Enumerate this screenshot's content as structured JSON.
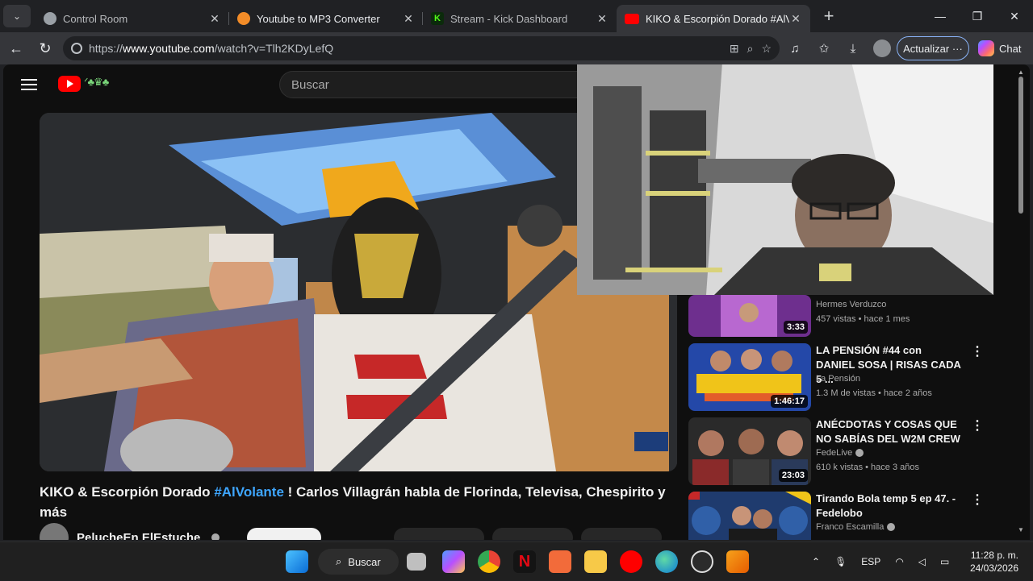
{
  "browser": {
    "tabs": [
      {
        "title": "Control Room",
        "favicon_color": "#9aa0a6",
        "active": false
      },
      {
        "title": "Youtube to MP3 Converter",
        "favicon_color": "#f28c28",
        "active": false
      },
      {
        "title": "Stream - Kick Dashboard",
        "favicon_color": "#53fc18",
        "active": false
      },
      {
        "title": "KIKO & Escorpión Dorado #AlVola",
        "favicon_color": "#ff0000",
        "active": true
      }
    ],
    "url_prefix": "https://",
    "url_host": "www.youtube.com",
    "url_path": "/watch?v=Tlh2KDyLefQ",
    "update_label": "Actualizar",
    "chat_label": "Chat"
  },
  "youtube": {
    "search_placeholder": "Buscar",
    "video_title": "KIKO & Escorpión Dorado",
    "video_hashtag": "#AlVolante",
    "video_title_rest": "! Carlos Villagrán habla de Florinda, Televisa, Chespirito y más",
    "channel_name": "PelucheEn ElEstuche",
    "recommendations": [
      {
        "title": "",
        "channel": "Hermes Verduzco",
        "meta": "457 vistas • hace 1 mes",
        "duration": "3:33",
        "verified": false
      },
      {
        "title": "LA PENSIÓN #44 con DANIEL SOSA | RISAS CADA 5 ...",
        "channel": "La Pensión",
        "meta": "1.3 M de vistas • hace 2 años",
        "duration": "1:46:17",
        "verified": false
      },
      {
        "title": "ANÉCDOTAS Y COSAS QUE NO SABÍAS DEL W2M CREW",
        "channel": "FedeLive",
        "meta": "610 k vistas • hace 3 años",
        "duration": "23:03",
        "verified": true
      },
      {
        "title": "Tirando Bola temp 5 ep 47. - Fedelobo",
        "channel": "Franco Escamilla",
        "meta": "",
        "duration": "",
        "verified": true
      }
    ]
  },
  "taskbar": {
    "search_label": "Buscar",
    "language": "ESP",
    "time": "11:28 p. m.",
    "date": "24/03/2026"
  },
  "icons": {
    "back": "arrow-left-icon",
    "reload": "reload-icon",
    "star": "star-icon",
    "download": "download-icon",
    "menu": "hamburger-icon"
  }
}
